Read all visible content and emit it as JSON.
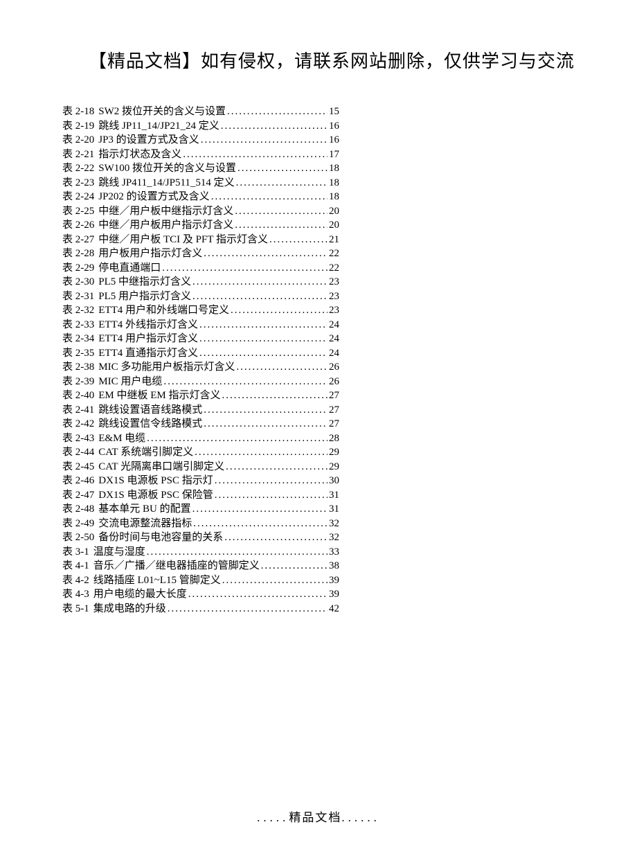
{
  "header": "【精品文档】如有侵权，请联系网站删除，仅供学习与交流",
  "footer": {
    "left_dots": ".....",
    "text": "精品文档",
    "right_dots": "......"
  },
  "toc": [
    {
      "label": "表 2-18",
      "title": "SW2 拨位开关的含义与设置",
      "page": "15"
    },
    {
      "label": "表 2-19",
      "title": "跳线 JP11_14/JP21_24 定义",
      "page": "16"
    },
    {
      "label": "表 2-20",
      "title": "JP3 的设置方式及含义",
      "page": "16"
    },
    {
      "label": "表 2-21",
      "title": "指示灯状态及含义",
      "page": "17"
    },
    {
      "label": "表 2-22",
      "title": "SW100 拨位开关的含义与设置",
      "page": "18"
    },
    {
      "label": "表 2-23",
      "title": "跳线 JP411_14/JP511_514 定义",
      "page": "18"
    },
    {
      "label": "表 2-24",
      "title": "JP202 的设置方式及含义",
      "page": "18"
    },
    {
      "label": "表 2-25",
      "title": "中继／用户板中继指示灯含义",
      "page": "20"
    },
    {
      "label": "表 2-26",
      "title": "中继／用户板用户指示灯含义",
      "page": "20"
    },
    {
      "label": "表 2-27",
      "title": "中继／用户板 TCI 及 PFT 指示灯含义",
      "page": "21"
    },
    {
      "label": "表 2-28",
      "title": "用户板用户指示灯含义",
      "page": "22"
    },
    {
      "label": "表 2-29",
      "title": " 停电直通端口",
      "page": "22"
    },
    {
      "label": "表 2-30",
      "title": "PL5 中继指示灯含义",
      "page": "23"
    },
    {
      "label": "表 2-31",
      "title": "PL5 用户指示灯含义",
      "page": "23"
    },
    {
      "label": "表 2-32",
      "title": "ETT4 用户和外线端口号定义",
      "page": "23"
    },
    {
      "label": "表 2-33",
      "title": "ETT4 外线指示灯含义",
      "page": "24"
    },
    {
      "label": "表 2-34",
      "title": "ETT4 用户指示灯含义",
      "page": "24"
    },
    {
      "label": "表 2-35",
      "title": "ETT4 直通指示灯含义",
      "page": "24"
    },
    {
      "label": "表 2-38",
      "title": "MIC 多功能用户板指示灯含义",
      "page": "26"
    },
    {
      "label": "表 2-39",
      "title": " MIC 用户电缆",
      "page": "26"
    },
    {
      "label": "表 2-40",
      "title": "EM 中继板 EM 指示灯含义",
      "page": "27"
    },
    {
      "label": "表 2-41",
      "title": "跳线设置语音线路模式",
      "page": "27"
    },
    {
      "label": "表 2-42",
      "title": "跳线设置信令线路模式",
      "page": "27"
    },
    {
      "label": "表 2-43",
      "title": "E&M 电缆",
      "page": "28"
    },
    {
      "label": "表 2-44",
      "title": "CAT 系统端引脚定义",
      "page": "29"
    },
    {
      "label": "表 2-45",
      "title": "CAT 光隔离串口端引脚定义",
      "page": "29"
    },
    {
      "label": "表 2-46",
      "title": "DX1S 电源板 PSC 指示灯",
      "page": "30"
    },
    {
      "label": "表 2-47",
      "title": "DX1S 电源板 PSC 保险管",
      "page": "31"
    },
    {
      "label": "表 2-48",
      "title": " 基本单元 BU 的配置",
      "page": "31"
    },
    {
      "label": "表 2-49",
      "title": " 交流电源整流器指标",
      "page": "32"
    },
    {
      "label": "表 2-50",
      "title": " 备份时间与电池容量的关系",
      "page": "32"
    },
    {
      "label": "表 3-1",
      "title": "  温度与湿度",
      "page": "33"
    },
    {
      "label": "表 4-1",
      "title": " 音乐／广播／继电器插座的管脚定义",
      "page": "38"
    },
    {
      "label": "表 4-2",
      "title": "  线路插座 L01~L15 管脚定义",
      "page": "39"
    },
    {
      "label": "表 4-3",
      "title": "  用户电缆的最大长度",
      "page": "39"
    },
    {
      "label": "表 5-1",
      "title": "  集成电路的升级",
      "page": "42"
    }
  ]
}
